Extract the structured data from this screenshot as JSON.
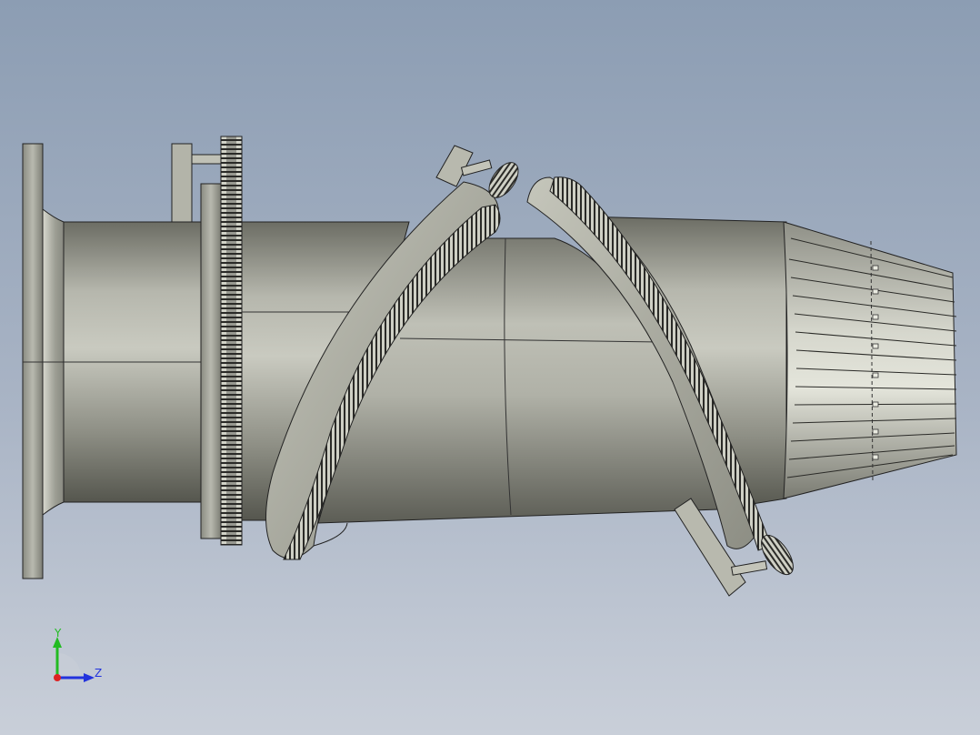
{
  "viewport": {
    "background_top": "#8c9db3",
    "background_bottom": "#c9cfd9"
  },
  "model": {
    "body_color": "#a9aa9e",
    "edge_color": "#1e1e1c",
    "gear_color": "#c8c9be"
  },
  "triad": {
    "y_label": "Y",
    "z_label": "Z",
    "y_color": "#22bb22",
    "z_color": "#2233dd",
    "x_color": "#dd2222"
  }
}
